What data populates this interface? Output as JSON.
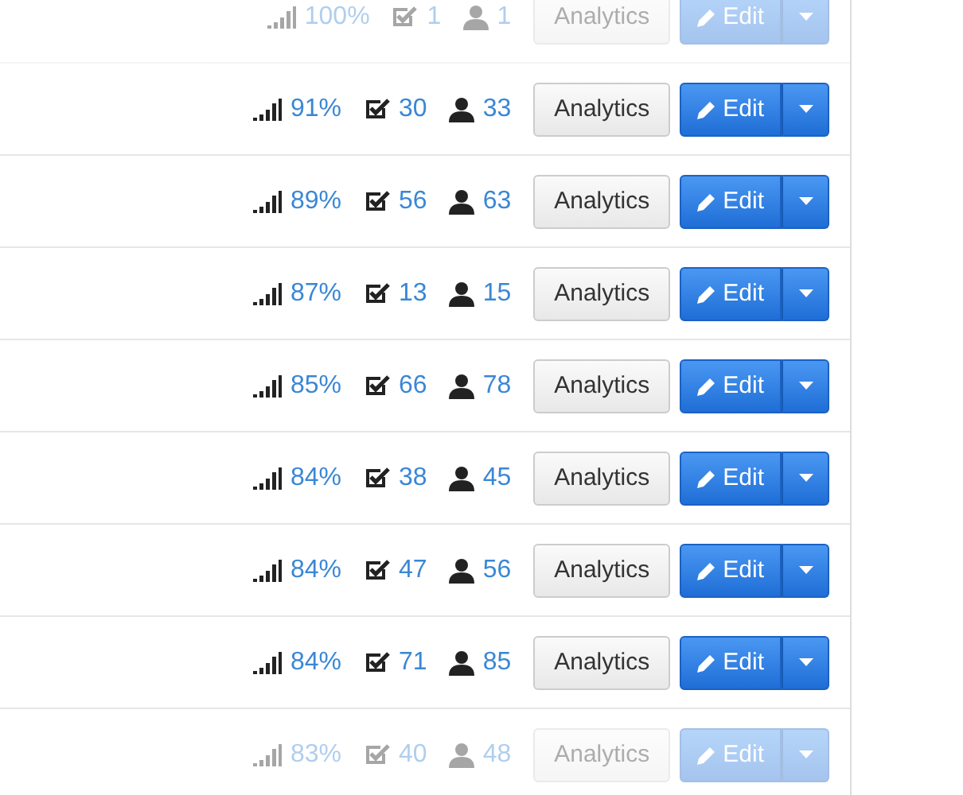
{
  "rows": [
    {
      "score": "100%",
      "tasks": "1",
      "users": "1",
      "analytics": "Analytics",
      "edit": "Edit"
    },
    {
      "score": "91%",
      "tasks": "30",
      "users": "33",
      "analytics": "Analytics",
      "edit": "Edit"
    },
    {
      "score": "89%",
      "tasks": "56",
      "users": "63",
      "analytics": "Analytics",
      "edit": "Edit"
    },
    {
      "score": "87%",
      "tasks": "13",
      "users": "15",
      "analytics": "Analytics",
      "edit": "Edit"
    },
    {
      "score": "85%",
      "tasks": "66",
      "users": "78",
      "analytics": "Analytics",
      "edit": "Edit"
    },
    {
      "score": "84%",
      "tasks": "38",
      "users": "45",
      "analytics": "Analytics",
      "edit": "Edit"
    },
    {
      "score": "84%",
      "tasks": "47",
      "users": "56",
      "analytics": "Analytics",
      "edit": "Edit"
    },
    {
      "score": "84%",
      "tasks": "71",
      "users": "85",
      "analytics": "Analytics",
      "edit": "Edit"
    },
    {
      "score": "83%",
      "tasks": "40",
      "users": "48",
      "analytics": "Analytics",
      "edit": "Edit"
    }
  ]
}
